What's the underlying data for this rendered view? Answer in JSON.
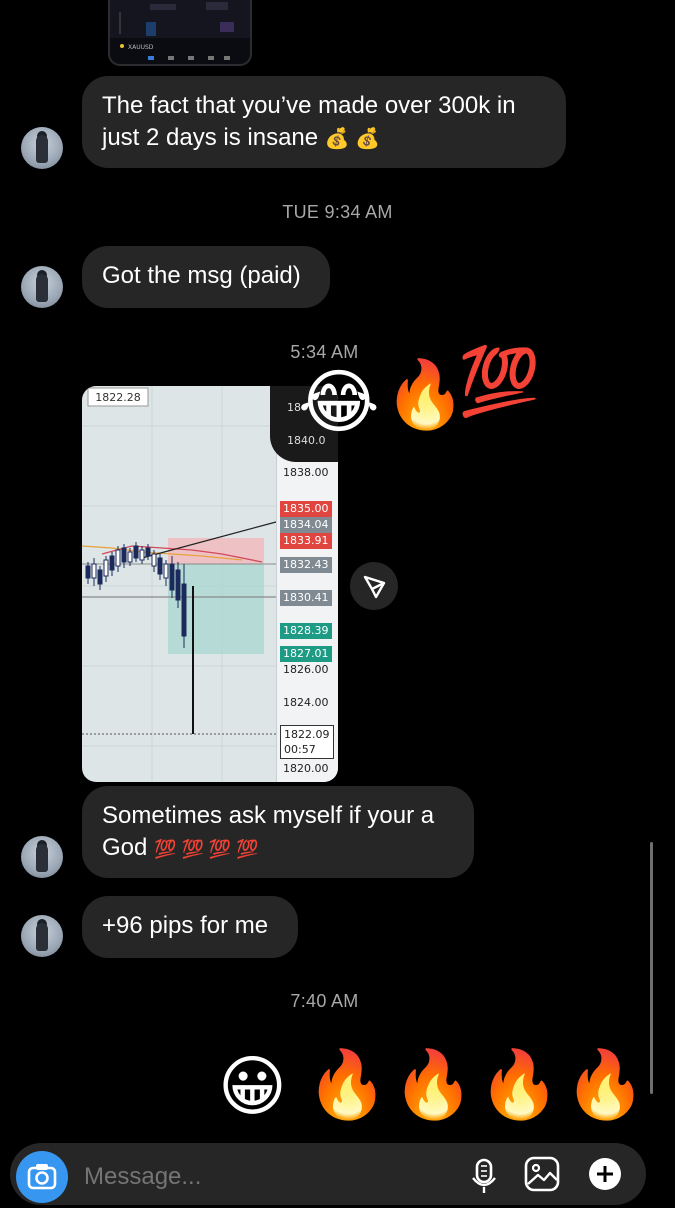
{
  "top_screenshot": {
    "caption": "XAUUSD"
  },
  "messages": [
    {
      "text": "The fact that you’ve made over 300k in just 2 days is insane",
      "emoji": "💰 💰"
    },
    {
      "timestamp": "TUE 9:34 AM"
    },
    {
      "text": "Got the msg (paid)"
    },
    {
      "timestamp": "5:34 AM"
    },
    {
      "reactions": [
        "😂",
        "🔥",
        "💯"
      ]
    },
    {
      "text": "Sometimes ask myself if your a God",
      "emoji": "💯 💯 💯 💯"
    },
    {
      "text": "+96 pips for me"
    },
    {
      "timestamp": "7:40 AM"
    },
    {
      "reactions_row": [
        "😀",
        "🔥",
        "🔥",
        "🔥",
        "🔥"
      ]
    }
  ],
  "chart_image": {
    "top_left_price": "1822.28",
    "price_labels": {
      "p1840": "1840.0",
      "p1838": "1838.00",
      "p1835": "1835.00",
      "p1834": "1834.04",
      "p1833": "1833.91",
      "p1832": "1832.43",
      "p1830": "1830.41",
      "p1828": "1828.39",
      "p1827": "1827.01",
      "p1826": "1826.00",
      "p1824": "1824.00",
      "p1822": "1822.09",
      "p1822_time": "00:57",
      "p1820": "1820.00",
      "p18": "18"
    }
  },
  "composer": {
    "placeholder": "Message...",
    "icons": [
      "camera-icon",
      "microphone-icon",
      "gallery-icon",
      "plus-icon"
    ]
  },
  "colors": {
    "bubble": "#262626",
    "background": "#000000",
    "camera_button": "#3797f0",
    "timestamp": "#a8a8a8"
  }
}
